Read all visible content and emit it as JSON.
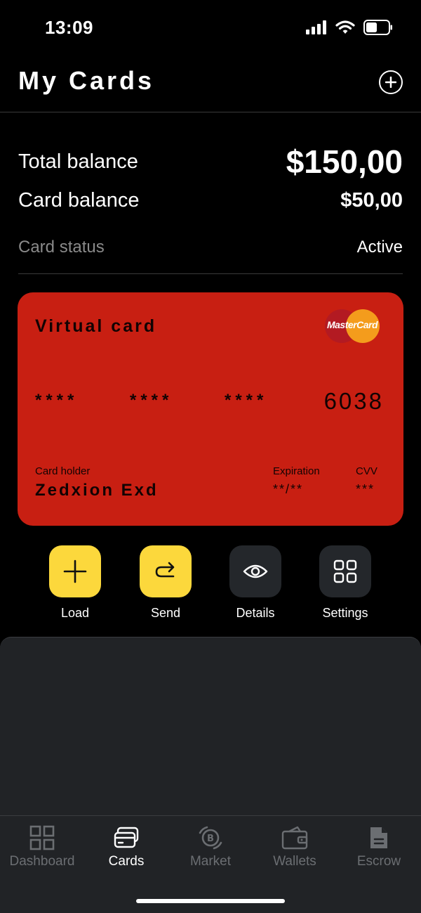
{
  "status_bar": {
    "time": "13:09"
  },
  "header": {
    "title": "My Cards"
  },
  "balances": {
    "total_label": "Total balance",
    "total_value": "$150,00",
    "card_label": "Card balance",
    "card_value": "$50,00",
    "status_label": "Card status",
    "status_value": "Active"
  },
  "card": {
    "type": "Virtual card",
    "brand": "MasterCard",
    "mask_1": "****",
    "mask_2": "****",
    "mask_3": "****",
    "last4": "6038",
    "holder_label": "Card holder",
    "holder_name": "Zedxion Exd",
    "expiration_label": "Expiration",
    "expiration_value": "**/**",
    "cvv_label": "CVV",
    "cvv_value": "***",
    "color": "#c81f12"
  },
  "actions": [
    {
      "label": "Load",
      "icon": "plus-icon"
    },
    {
      "label": "Send",
      "icon": "send-arrow-icon"
    },
    {
      "label": "Details",
      "icon": "eye-icon"
    },
    {
      "label": "Settings",
      "icon": "grid-icon"
    }
  ],
  "tabs": [
    {
      "label": "Dashboard",
      "icon": "dashboard-icon",
      "active": false
    },
    {
      "label": "Cards",
      "icon": "cards-icon",
      "active": true
    },
    {
      "label": "Market",
      "icon": "market-icon",
      "active": false
    },
    {
      "label": "Wallets",
      "icon": "wallet-icon",
      "active": false
    },
    {
      "label": "Escrow",
      "icon": "document-icon",
      "active": false
    }
  ],
  "colors": {
    "accent": "#fcd83c",
    "card_red": "#c81f12",
    "surface": "#212326"
  }
}
